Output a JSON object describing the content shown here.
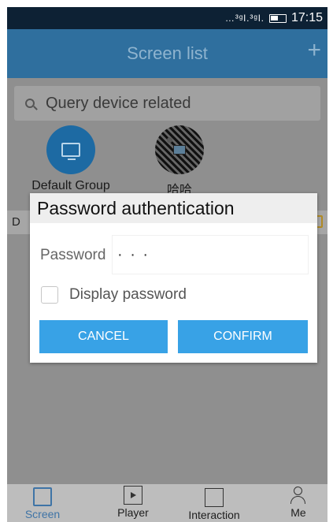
{
  "status_bar": {
    "signal": "…³ᵍl.³ᵍl.",
    "time": "17:15"
  },
  "app_bar": {
    "title": "Screen list",
    "add_label": "+"
  },
  "search": {
    "placeholder": "Query device related"
  },
  "groups": [
    {
      "label": "Default Group",
      "icon": "monitor-icon"
    },
    {
      "label": "哈哈",
      "icon": "group-avatar"
    }
  ],
  "list_header": {
    "prefix": "D"
  },
  "dialog": {
    "title": "Password authentication",
    "password_label": "Password",
    "password_value": "· · ·",
    "display_password_label": "Display password",
    "cancel_label": "CANCEL",
    "confirm_label": "CONFIRM"
  },
  "tabs": [
    {
      "label": "Screen",
      "icon": "monitor-icon",
      "active": true
    },
    {
      "label": "Player",
      "icon": "player-icon",
      "active": false
    },
    {
      "label": "Interaction",
      "icon": "interaction-icon",
      "active": false
    },
    {
      "label": "Me",
      "icon": "person-icon",
      "active": false
    }
  ],
  "colors": {
    "app_bar": "#2f6f9e",
    "button": "#38a2e6",
    "active_tab": "#3f74a6"
  }
}
